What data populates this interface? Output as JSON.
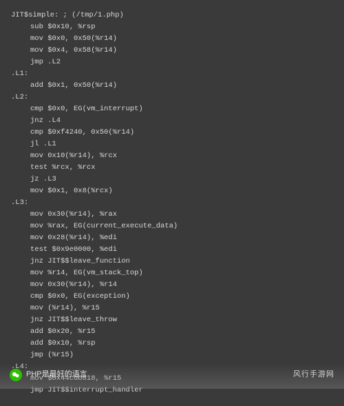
{
  "code": {
    "lines": [
      {
        "t": "JIT$simple: ; (/tmp/1.php)",
        "i": 0
      },
      {
        "t": "sub $0x10, %rsp",
        "i": 1
      },
      {
        "t": "mov $0x0, 0x50(%r14)",
        "i": 1
      },
      {
        "t": "mov $0x4, 0x58(%r14)",
        "i": 1
      },
      {
        "t": "jmp .L2",
        "i": 1
      },
      {
        "t": ".L1:",
        "i": 0
      },
      {
        "t": "add $0x1, 0x50(%r14)",
        "i": 1
      },
      {
        "t": ".L2:",
        "i": 0
      },
      {
        "t": "cmp $0x0, EG(vm_interrupt)",
        "i": 1
      },
      {
        "t": "jnz .L4",
        "i": 1
      },
      {
        "t": "cmp $0xf4240, 0x50(%r14)",
        "i": 1
      },
      {
        "t": "jl .L1",
        "i": 1
      },
      {
        "t": "mov 0x10(%r14), %rcx",
        "i": 1
      },
      {
        "t": "test %rcx, %rcx",
        "i": 1
      },
      {
        "t": "jz .L3",
        "i": 1
      },
      {
        "t": "mov $0x1, 0x8(%rcx)",
        "i": 1
      },
      {
        "t": ".L3:",
        "i": 0
      },
      {
        "t": "mov 0x30(%r14), %rax",
        "i": 1
      },
      {
        "t": "mov %rax, EG(current_execute_data)",
        "i": 1
      },
      {
        "t": "mov 0x28(%r14), %edi",
        "i": 1
      },
      {
        "t": "test $0x9e0000, %edi",
        "i": 1
      },
      {
        "t": "jnz JIT$$leave_function",
        "i": 1
      },
      {
        "t": "mov %r14, EG(vm_stack_top)",
        "i": 1
      },
      {
        "t": "mov 0x30(%r14), %r14",
        "i": 1
      },
      {
        "t": "cmp $0x0, EG(exception)",
        "i": 1
      },
      {
        "t": "mov (%r14), %r15",
        "i": 1
      },
      {
        "t": "jnz JIT$$leave_throw",
        "i": 1
      },
      {
        "t": "add $0x20, %r15",
        "i": 1
      },
      {
        "t": "add $0x10, %rsp",
        "i": 1
      },
      {
        "t": "jmp (%r15)",
        "i": 1
      },
      {
        "t": ".L4:",
        "i": 0
      },
      {
        "t": "mov $0x44cdb818, %r15",
        "i": 1
      },
      {
        "t": "jmp JIT$$interrupt_handler",
        "i": 1
      }
    ]
  },
  "watermark": {
    "left_text": "PHP是最好的语言",
    "right_text": "风行手游网"
  }
}
